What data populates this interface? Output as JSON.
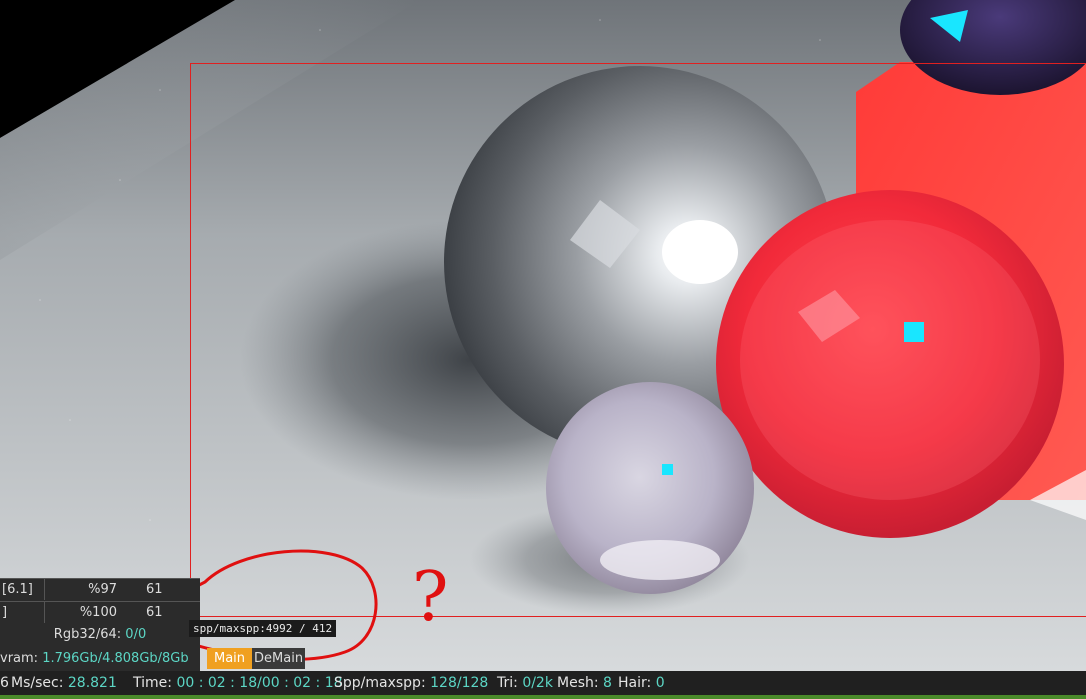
{
  "stats_table": {
    "rows": [
      {
        "label": "[6.1]",
        "percent": "%97",
        "value": "61"
      },
      {
        "label": "]",
        "percent": "%100",
        "value": "61"
      }
    ]
  },
  "format": {
    "label": "Rgb32/64: ",
    "value": "0/0"
  },
  "vram": {
    "label": "vram: ",
    "value": "1.796Gb/4.808Gb/8Gb"
  },
  "tooltip": {
    "text": "spp/maxspp:4992 / 412"
  },
  "tabs": {
    "main": "Main",
    "demain": "DeMain"
  },
  "status_bar": {
    "prefix": "6",
    "ms_label": "Ms/sec: ",
    "ms_value": "28.821",
    "time_label": "Time: ",
    "time_value": "00 : 02 : 18/00 : 02 : 18",
    "spp_label": "Spp/maxspp: ",
    "spp_value": "128/128",
    "tri_label": "Tri: ",
    "tri_value": "0/2k",
    "mesh_label": "Mesh: ",
    "mesh_value": "8",
    "hair_label": "Hair: ",
    "hair_value": "0"
  },
  "annotation": {
    "mark": "?"
  },
  "colors": {
    "region_border": "#e02020",
    "tab_active": "#f0a020",
    "value_text": "#5cd6c5",
    "status_indicator": "#4a8a2a"
  }
}
